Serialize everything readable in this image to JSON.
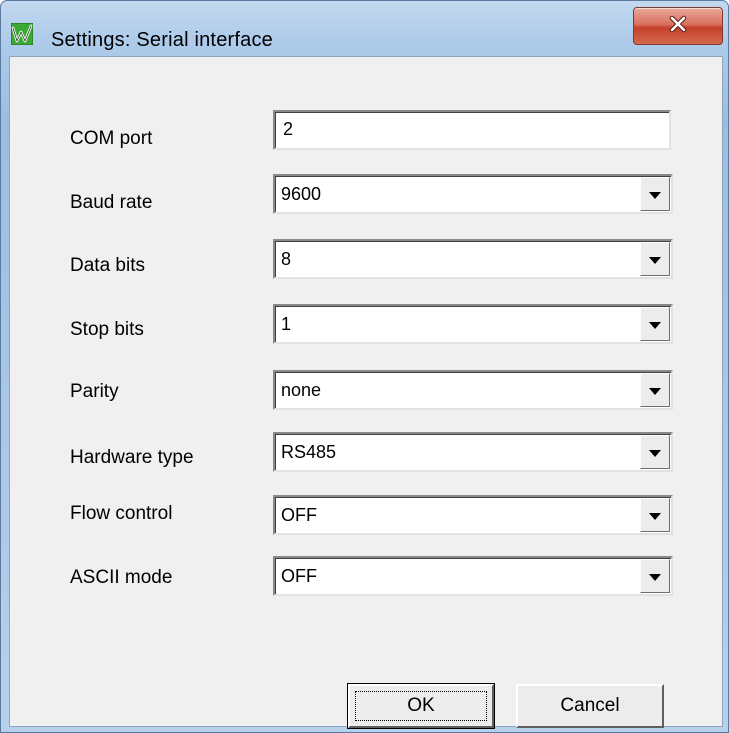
{
  "window": {
    "title": "Settings: Serial interface",
    "icon": "app-logo-w-icon",
    "close": "close-icon"
  },
  "fields": [
    {
      "label": "COM port",
      "value": "2",
      "type": "text"
    },
    {
      "label": "Baud rate",
      "value": "9600",
      "type": "select"
    },
    {
      "label": "Data bits",
      "value": "8",
      "type": "select"
    },
    {
      "label": "Stop bits",
      "value": "1",
      "type": "select"
    },
    {
      "label": "Parity",
      "value": "none",
      "type": "select"
    },
    {
      "label": "Hardware type",
      "value": "RS485",
      "type": "select"
    },
    {
      "label": "Flow control",
      "value": "OFF",
      "type": "select"
    },
    {
      "label": "ASCII mode",
      "value": "OFF",
      "type": "select"
    }
  ],
  "buttons": {
    "ok": "OK",
    "cancel": "Cancel"
  },
  "colors": {
    "frame": "#aecbea",
    "client": "#f0f0f0",
    "close_button": "#c4402a",
    "logo_green": "#3aa935"
  }
}
